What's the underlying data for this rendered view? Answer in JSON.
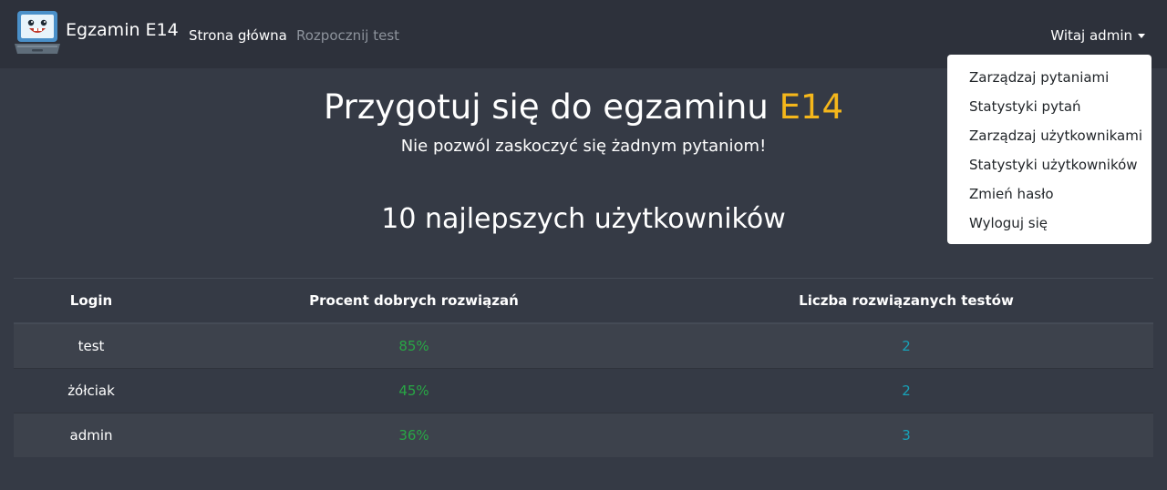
{
  "navbar": {
    "brand": "Egzamin E14",
    "links": [
      {
        "label": "Strona główna"
      },
      {
        "label": "Rozpocznij test"
      }
    ],
    "user_menu": "Witaj admin"
  },
  "dropdown": {
    "items": [
      {
        "label": "Zarządzaj pytaniami"
      },
      {
        "label": "Statystyki pytań"
      },
      {
        "label": "Zarządzaj użytkownikami"
      },
      {
        "label": "Statystyki użytkowników"
      },
      {
        "label": "Zmień hasło"
      },
      {
        "label": "Wyloguj się"
      }
    ]
  },
  "hero": {
    "title": "Przygotuj się do egzaminu",
    "title_accent": "E14",
    "subtitle": "Nie pozwól zaskoczyć się żadnym pytaniom!"
  },
  "leaderboard": {
    "title": "10 najlepszych użytkowników",
    "columns": [
      "Login",
      "Procent dobrych rozwiązań",
      "Liczba rozwiązanych testów"
    ],
    "rows": [
      {
        "login": "test",
        "percent": "85%",
        "tests": "2"
      },
      {
        "login": "żółciak",
        "percent": "45%",
        "tests": "2"
      },
      {
        "login": "admin",
        "percent": "36%",
        "tests": "3"
      }
    ]
  },
  "colors": {
    "background": "#353a45",
    "navbar": "#2d313b",
    "accent": "#f5b71b",
    "percent": "#28a745",
    "tests": "#17a2b8"
  },
  "icons": {
    "brand_logo": "laptop-mascot-icon",
    "user_caret": "caret-down-icon"
  }
}
